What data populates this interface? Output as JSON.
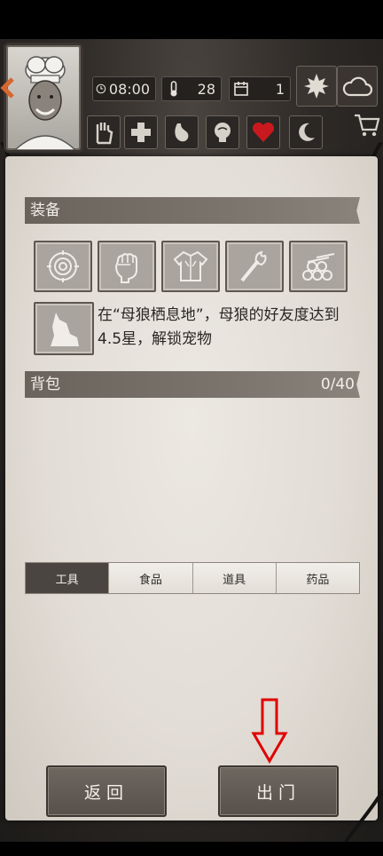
{
  "hud": {
    "time": "08:00",
    "temperature": "28",
    "day": "1"
  },
  "equipment": {
    "title": "装备",
    "slots": [
      "target-icon",
      "fist-icon",
      "armor-icon",
      "torch-icon",
      "logs-icon"
    ],
    "pet_hint": "在“母狼栖息地”，母狼的好友度达到4.5星，解锁宠物"
  },
  "backpack": {
    "title": "背包",
    "count": "0/40"
  },
  "tabs": [
    {
      "label": "工具",
      "active": true
    },
    {
      "label": "食品",
      "active": false
    },
    {
      "label": "道具",
      "active": false
    },
    {
      "label": "药品",
      "active": false
    }
  ],
  "buttons": {
    "back": "返回",
    "go_out": "出门"
  },
  "colors": {
    "panel": "#e6e1da",
    "header": "#6f6861",
    "annotation_arrow": "#e00000"
  }
}
